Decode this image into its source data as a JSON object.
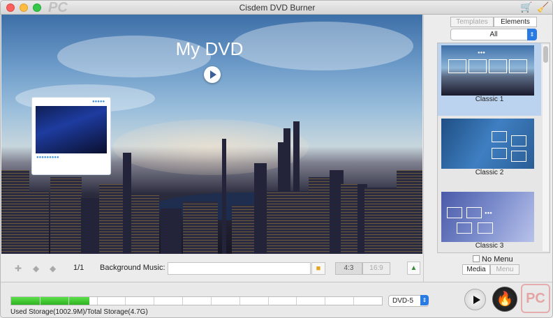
{
  "app": {
    "title": "Cisdem DVD Burner",
    "watermark_text": "PC",
    "corner_logo_text": "PC"
  },
  "preview": {
    "dvd_title": "My DVD"
  },
  "toolbar": {
    "page_indicator": "1/1",
    "background_music_label": "Background Music:",
    "background_music_value": "",
    "ratio_4_3": "4:3",
    "ratio_16_9": "16:9"
  },
  "sidebar": {
    "tabs": [
      {
        "label": "Templates",
        "active": false
      },
      {
        "label": "Elements",
        "active": true
      }
    ],
    "filter": {
      "selected": "All"
    },
    "templates": [
      {
        "label": "Classic 1",
        "selected": true
      },
      {
        "label": "Classic 2",
        "selected": false
      },
      {
        "label": "Classic 3",
        "selected": false
      }
    ],
    "no_menu_label": "No Menu",
    "no_menu_checked": false,
    "mode_tabs": [
      {
        "label": "Media",
        "active": true
      },
      {
        "label": "Menu",
        "active": false
      }
    ]
  },
  "footer": {
    "storage_text": "Used Storage(1002.9M)/Total Storage(4.7G)",
    "storage_used_fraction": 0.21,
    "disc_type": "DVD-5"
  },
  "colors": {
    "accent": "#2a7ae4",
    "progress_green": "#3cc22e"
  },
  "icons": [
    "cart-icon",
    "brush-icon",
    "add-icon",
    "previous-icon",
    "next-icon",
    "folder-icon",
    "image-icon",
    "play-icon",
    "burn-icon"
  ]
}
